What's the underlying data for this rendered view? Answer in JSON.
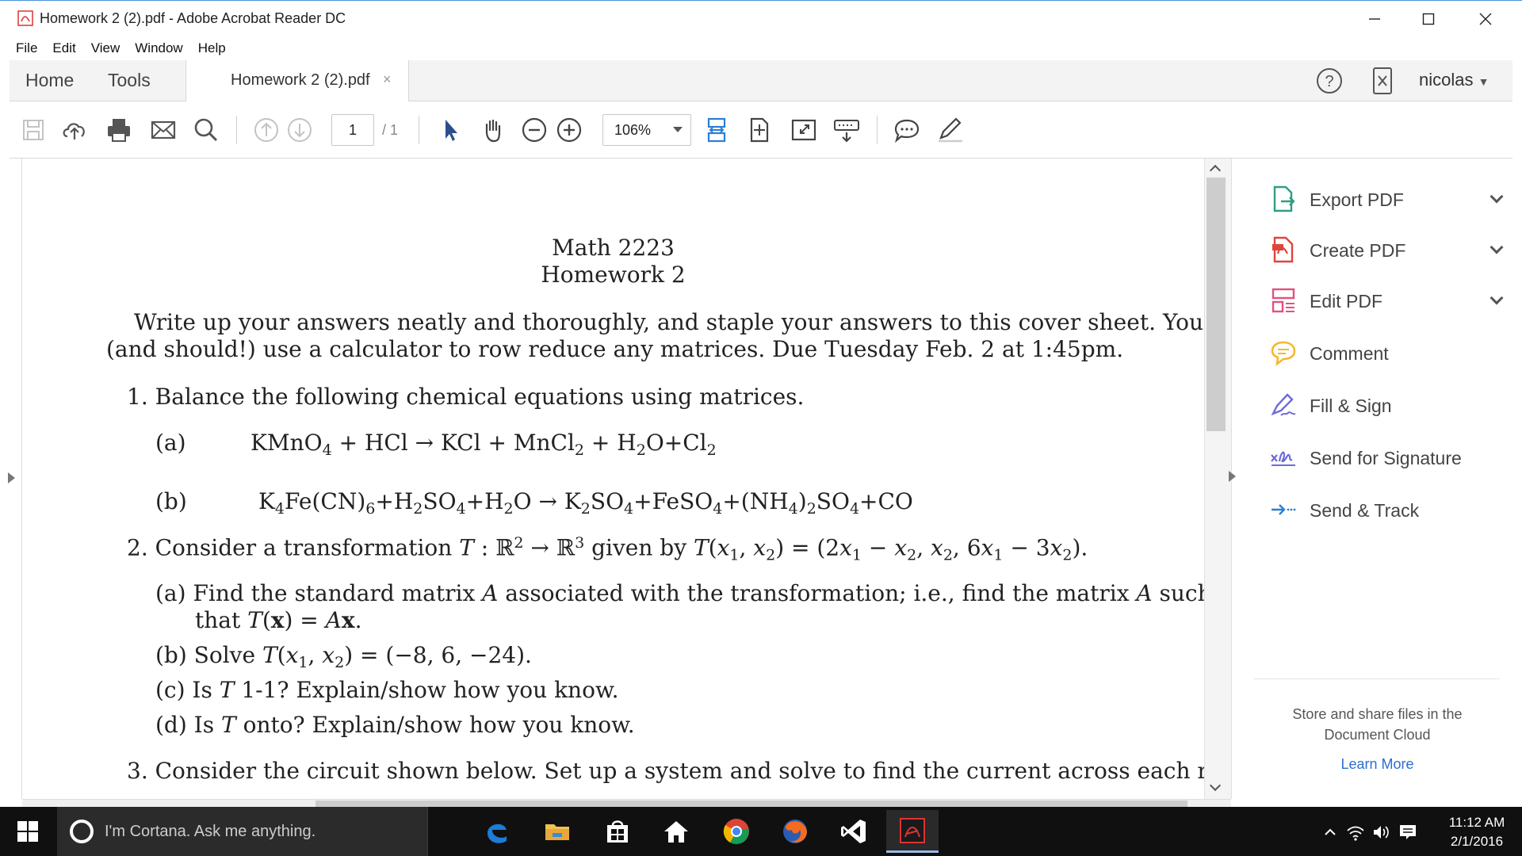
{
  "window": {
    "title": "Homework 2 (2).pdf - Adobe Acrobat Reader DC"
  },
  "menu": [
    "File",
    "Edit",
    "View",
    "Window",
    "Help"
  ],
  "tabs": {
    "home": "Home",
    "tools": "Tools",
    "document": "Homework 2 (2).pdf",
    "close": "×",
    "user": "nicolas"
  },
  "toolbar": {
    "page_current": "1",
    "page_total": "/ 1",
    "zoom": "106%"
  },
  "document": {
    "course": "Math 2223",
    "title": "Homework 2",
    "intro_line1": "Write up your answers neatly and thoroughly, and staple your answers to this cover sheet. You may",
    "intro_line2": "(and should!) use a calculator to row reduce any matrices. Due Tuesday Feb. 2 at 1:45pm.",
    "q1": "1. Balance the following chemical equations using matrices.",
    "q1a_label": "(a)",
    "q1b_label": "(b)",
    "q2_prefix": "2. Consider a transformation",
    "q2_given": "given by",
    "q2a_line1_prefix": "(a) Find the standard matrix",
    "q2a_line1_mid": "associated with the transformation; i.e., find the matrix",
    "q2a_line1_suffix": "such",
    "q2a_line2_prefix": "that",
    "q2b_prefix": "(b) Solve",
    "q2c_prefix": "(c) Is",
    "q2c_suffix": "1-1? Explain/show how you know.",
    "q2d_prefix": "(d) Is",
    "q2d_suffix": "onto? Explain/show how you know.",
    "q3": "3. Consider the circuit shown below. Set up a system and solve to find the current across each resistor."
  },
  "right_panel": {
    "items": [
      {
        "label": "Export PDF",
        "icon": "export-pdf-icon",
        "color": "#2e9e86"
      },
      {
        "label": "Create PDF",
        "icon": "create-pdf-icon",
        "color": "#e0443b"
      },
      {
        "label": "Edit PDF",
        "icon": "edit-pdf-icon",
        "color": "#e0527e"
      },
      {
        "label": "Comment",
        "icon": "comment-icon",
        "color": "#f3b92b"
      },
      {
        "label": "Fill & Sign",
        "icon": "fill-sign-icon",
        "color": "#6e6bd9"
      },
      {
        "label": "Send for Signature",
        "icon": "send-signature-icon",
        "color": "#6e6bd9"
      },
      {
        "label": "Send & Track",
        "icon": "send-track-icon",
        "color": "#2a7fd4"
      }
    ],
    "store_line1": "Store and share files in the",
    "store_line2": "Document Cloud",
    "learn_more": "Learn More"
  },
  "taskbar": {
    "search_placeholder": "I'm Cortana. Ask me anything.",
    "time": "11:12 AM",
    "date": "2/1/2016"
  }
}
